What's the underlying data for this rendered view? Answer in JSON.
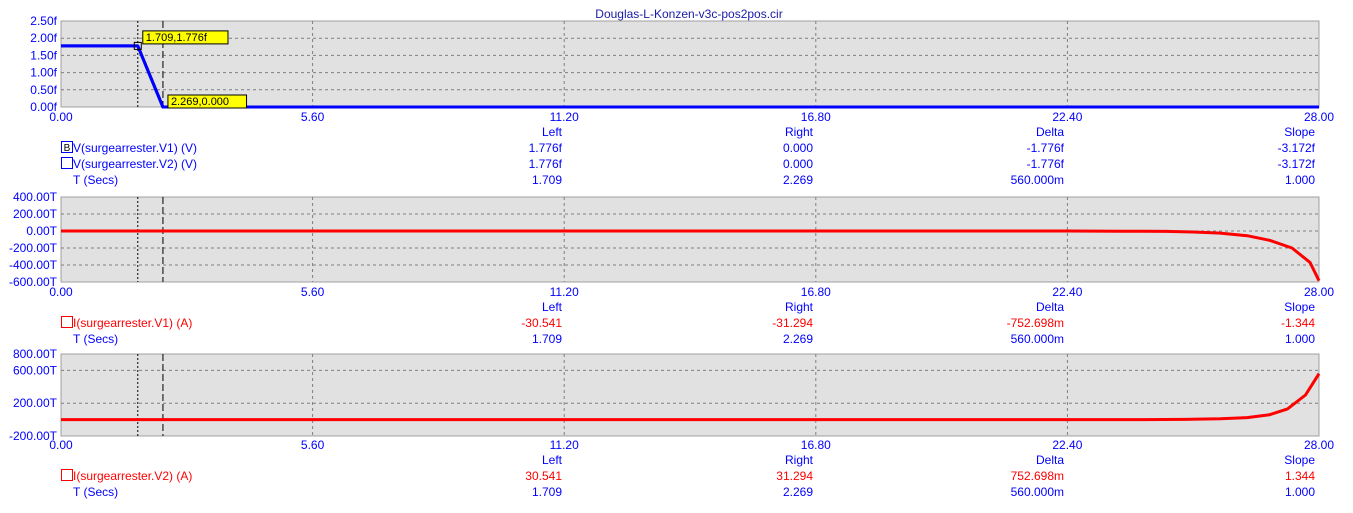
{
  "window": {
    "title": "Douglas-L-Konzen-v3c-pos2pos.cir"
  },
  "colors": {
    "plot_bg": "#e1e1e1",
    "grid": "#7f7f7f",
    "axis_text": "#0000ff",
    "voltage_trace": "#0000ff",
    "current_trace": "#ff0000",
    "label_box": "#ffff00"
  },
  "x_axis": {
    "ticks": [
      "0.00",
      "5.60",
      "11.20",
      "16.80",
      "22.40",
      "28.00"
    ],
    "range": [
      0,
      28
    ]
  },
  "cursors": {
    "left": 1.709,
    "right": 2.269
  },
  "tables": {
    "headers": {
      "left": "Left",
      "right": "Right",
      "delta": "Delta",
      "slope": "Slope"
    }
  },
  "chart_data": [
    {
      "type": "line",
      "title": "Douglas-L-Konzen-v3c-pos2pos.cir",
      "ylim": [
        0,
        2.5
      ],
      "y_ticks": [
        "2.50f",
        "2.00f",
        "1.50f",
        "1.00f",
        "0.50f",
        "0.00f"
      ],
      "y_tick_values": [
        2.5,
        2.0,
        1.5,
        1.0,
        0.5,
        0.0
      ],
      "series": [
        {
          "name": "V(surgearrester.V1) (V)",
          "color": "#0000ff",
          "x": [
            0,
            1.709,
            2.269,
            28
          ],
          "y": [
            1.776,
            1.776,
            0,
            0
          ]
        },
        {
          "name": "V(surgearrester.V2) (V)",
          "color": "#0000ff",
          "x": [
            0,
            1.709,
            2.269,
            28
          ],
          "y": [
            1.776,
            1.776,
            0,
            0
          ]
        }
      ],
      "annotations": [
        {
          "text": "1.709,1.776f",
          "x": 1.709,
          "y": 1.776,
          "anchor": "upper"
        },
        {
          "text": "2.269,0.000",
          "x": 2.269,
          "y": 0,
          "anchor": "lower"
        }
      ],
      "rows": [
        {
          "label": "V(surgearrester.V1) (V)",
          "marker": "B",
          "color": "#0000ff",
          "left": "1.776f",
          "right": "0.000",
          "delta": "-1.776f",
          "slope": "-3.172f"
        },
        {
          "label": "V(surgearrester.V2) (V)",
          "marker": "",
          "color": "#0000ff",
          "left": "1.776f",
          "right": "0.000",
          "delta": "-1.776f",
          "slope": "-3.172f"
        },
        {
          "label": "T (Secs)",
          "marker": null,
          "color": "#0000ff",
          "left": "1.709",
          "right": "2.269",
          "delta": "560.000m",
          "slope": "1.000"
        }
      ]
    },
    {
      "type": "line",
      "ylim": [
        -600,
        400
      ],
      "y_ticks": [
        "400.00T",
        "200.00T",
        "0.00T",
        "-200.00T",
        "-400.00T",
        "-600.00T"
      ],
      "y_tick_values": [
        400,
        200,
        0,
        -200,
        -400,
        -600
      ],
      "series": [
        {
          "name": "I(surgearrester.V1) (A)",
          "color": "#ff0000",
          "x": [
            0,
            22.4,
            23.6,
            24.6,
            25.2,
            25.8,
            26.4,
            26.9,
            27.4,
            27.8,
            28.0
          ],
          "y": [
            0,
            0,
            -2,
            -5,
            -12,
            -25,
            -55,
            -110,
            -200,
            -370,
            -585
          ]
        }
      ],
      "rows": [
        {
          "label": "I(surgearrester.V1) (A)",
          "marker": "",
          "color": "#ff0000",
          "left": "-30.541",
          "right": "-31.294",
          "delta": "-752.698m",
          "slope": "-1.344"
        },
        {
          "label": "T (Secs)",
          "marker": null,
          "color": "#0000ff",
          "left": "1.709",
          "right": "2.269",
          "delta": "560.000m",
          "slope": "1.000"
        }
      ]
    },
    {
      "type": "line",
      "ylim": [
        -200,
        800
      ],
      "y_ticks": [
        "800.00T",
        "600.00T",
        "200.00T",
        "-200.00T"
      ],
      "y_tick_values": [
        800,
        600,
        200,
        -200
      ],
      "series": [
        {
          "name": "I(surgearrester.V2) (A)",
          "color": "#ff0000",
          "x": [
            0,
            24.0,
            25.0,
            25.8,
            26.4,
            26.9,
            27.3,
            27.7,
            28.0
          ],
          "y": [
            0,
            0,
            3,
            10,
            25,
            60,
            130,
            300,
            560
          ]
        }
      ],
      "rows": [
        {
          "label": "I(surgearrester.V2) (A)",
          "marker": "",
          "color": "#ff0000",
          "left": "30.541",
          "right": "31.294",
          "delta": "752.698m",
          "slope": "1.344"
        },
        {
          "label": "T (Secs)",
          "marker": null,
          "color": "#0000ff",
          "left": "1.709",
          "right": "2.269",
          "delta": "560.000m",
          "slope": "1.000"
        }
      ]
    }
  ]
}
